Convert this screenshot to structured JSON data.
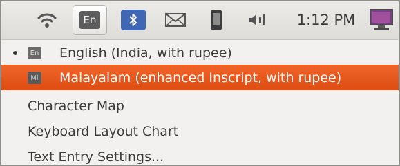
{
  "panel": {
    "keyboard_indicator": "En",
    "clock": "1:12 PM",
    "icons": [
      "wifi-icon",
      "keyboard-layout-icon",
      "bluetooth-icon",
      "mail-icon",
      "phone-icon",
      "volume-icon",
      "session-icon"
    ]
  },
  "menu": {
    "items": [
      {
        "label": "English (India, with rupee)",
        "icon_text": "En",
        "selected": true
      },
      {
        "label": "Malayalam (enhanced Inscript, with rupee)",
        "icon_text": "Ml",
        "highlighted": true
      },
      {
        "label": "Character Map"
      },
      {
        "label": "Keyboard Layout Chart"
      },
      {
        "label": "Text Entry Settings..."
      }
    ]
  },
  "colors": {
    "highlight": "#e85a1c",
    "panel": "#e5e4e1",
    "menu_bg": "#f2f1ef",
    "text": "#3c3c3c",
    "bluetooth": "#3f67b4"
  }
}
